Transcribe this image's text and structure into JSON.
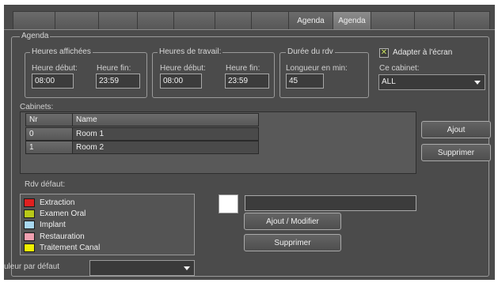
{
  "tabs": [
    {
      "label": ""
    },
    {
      "label": ""
    },
    {
      "label": ""
    },
    {
      "label": ""
    },
    {
      "label": ""
    },
    {
      "label": ""
    },
    {
      "label": ""
    },
    {
      "label": "Agenda"
    },
    {
      "label": ""
    },
    {
      "label": ""
    },
    {
      "label": ""
    }
  ],
  "agenda_group_title": "Agenda",
  "heures_affichees": {
    "title": "Heures affichées",
    "start_label": "Heure début:",
    "end_label": "Heure fin:",
    "start_value": "08:00",
    "end_value": "23:59"
  },
  "heures_travail": {
    "title": "Heures de travail:",
    "start_label": "Heure début:",
    "end_label": "Heure fin:",
    "start_value": "08:00",
    "end_value": "23:59"
  },
  "duree_rdv": {
    "title": "Durée du rdv",
    "length_label": "Longueur en min:",
    "length_value": "45"
  },
  "adapter": {
    "checkbox_label": "Adapter à l'écran",
    "checked": true,
    "cabinet_label": "Ce cabinet:",
    "cabinet_value": "ALL"
  },
  "cabinets": {
    "label": "Cabinets:",
    "columns": [
      "Nr",
      "Name"
    ],
    "rows": [
      {
        "nr": "0",
        "name": "Room 1"
      },
      {
        "nr": "1",
        "name": "Room 2"
      }
    ],
    "add_button": "Ajout",
    "delete_button": "Supprimer"
  },
  "rdv_defaut": {
    "label": "Rdv défaut:",
    "items": [
      {
        "label": "Extraction",
        "color": "#e02020"
      },
      {
        "label": "Examen Oral",
        "color": "#b8c818"
      },
      {
        "label": "Implant",
        "color": "#a8d8f0"
      },
      {
        "label": "Restauration",
        "color": "#f0a0b0"
      },
      {
        "label": "Traitement Canal",
        "color": "#f0f000"
      }
    ],
    "color_preview": "#ffffff",
    "name_value": "",
    "add_modify_button": "Ajout / Modifier",
    "delete_button": "Supprimer"
  },
  "default_color": {
    "label": "uleur par défaut",
    "value": ""
  }
}
